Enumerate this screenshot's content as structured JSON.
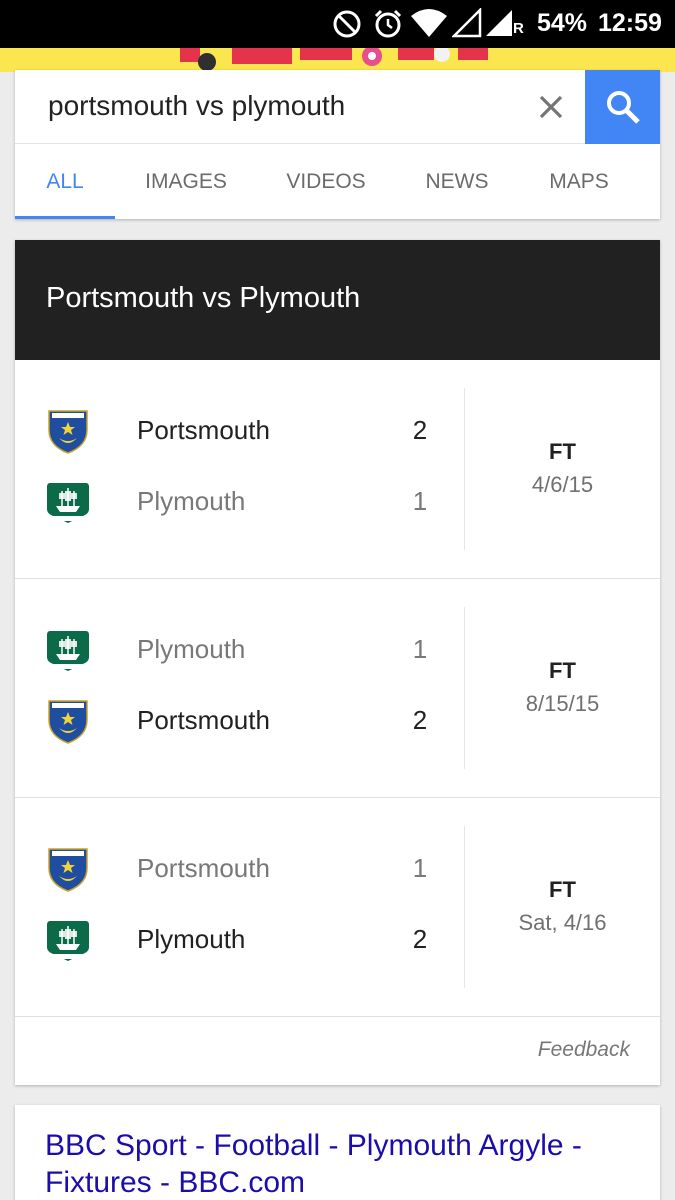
{
  "status_bar": {
    "battery": "54%",
    "time": "12:59",
    "network_label": "R",
    "icons": [
      "do-not-disturb-icon",
      "alarm-icon",
      "wifi-icon",
      "signal-icon",
      "signal-icon"
    ]
  },
  "search": {
    "query": "portsmouth vs plymouth",
    "clear_icon": "close-icon",
    "search_icon": "search-icon"
  },
  "tabs": [
    {
      "label": "ALL",
      "active": true
    },
    {
      "label": "IMAGES",
      "active": false
    },
    {
      "label": "VIDEOS",
      "active": false
    },
    {
      "label": "NEWS",
      "active": false
    },
    {
      "label": "MAPS",
      "active": false
    }
  ],
  "matchup": {
    "title": "Portsmouth vs Plymouth",
    "matches": [
      {
        "teams": [
          {
            "name": "Portsmouth",
            "score": "2",
            "crest": "portsmouth-crest-icon",
            "winner": true
          },
          {
            "name": "Plymouth",
            "score": "1",
            "crest": "plymouth-crest-icon",
            "winner": false
          }
        ],
        "status": "FT",
        "date": "4/6/15"
      },
      {
        "teams": [
          {
            "name": "Plymouth",
            "score": "1",
            "crest": "plymouth-crest-icon",
            "winner": false
          },
          {
            "name": "Portsmouth",
            "score": "2",
            "crest": "portsmouth-crest-icon",
            "winner": true
          }
        ],
        "status": "FT",
        "date": "8/15/15"
      },
      {
        "teams": [
          {
            "name": "Portsmouth",
            "score": "1",
            "crest": "portsmouth-crest-icon",
            "winner": false
          },
          {
            "name": "Plymouth",
            "score": "2",
            "crest": "plymouth-crest-icon",
            "winner": true
          }
        ],
        "status": "FT",
        "date": "Sat, 4/16"
      }
    ],
    "feedback": "Feedback"
  },
  "result": {
    "title": "BBC Sport - Football - Plymouth Argyle - Fixtures - BBC.com"
  },
  "colors": {
    "accent": "#4285f4",
    "header_bg": "#212121",
    "link": "#1a0dab",
    "portsmouth_blue": "#1f4ea1",
    "plymouth_green": "#0b6b48"
  }
}
